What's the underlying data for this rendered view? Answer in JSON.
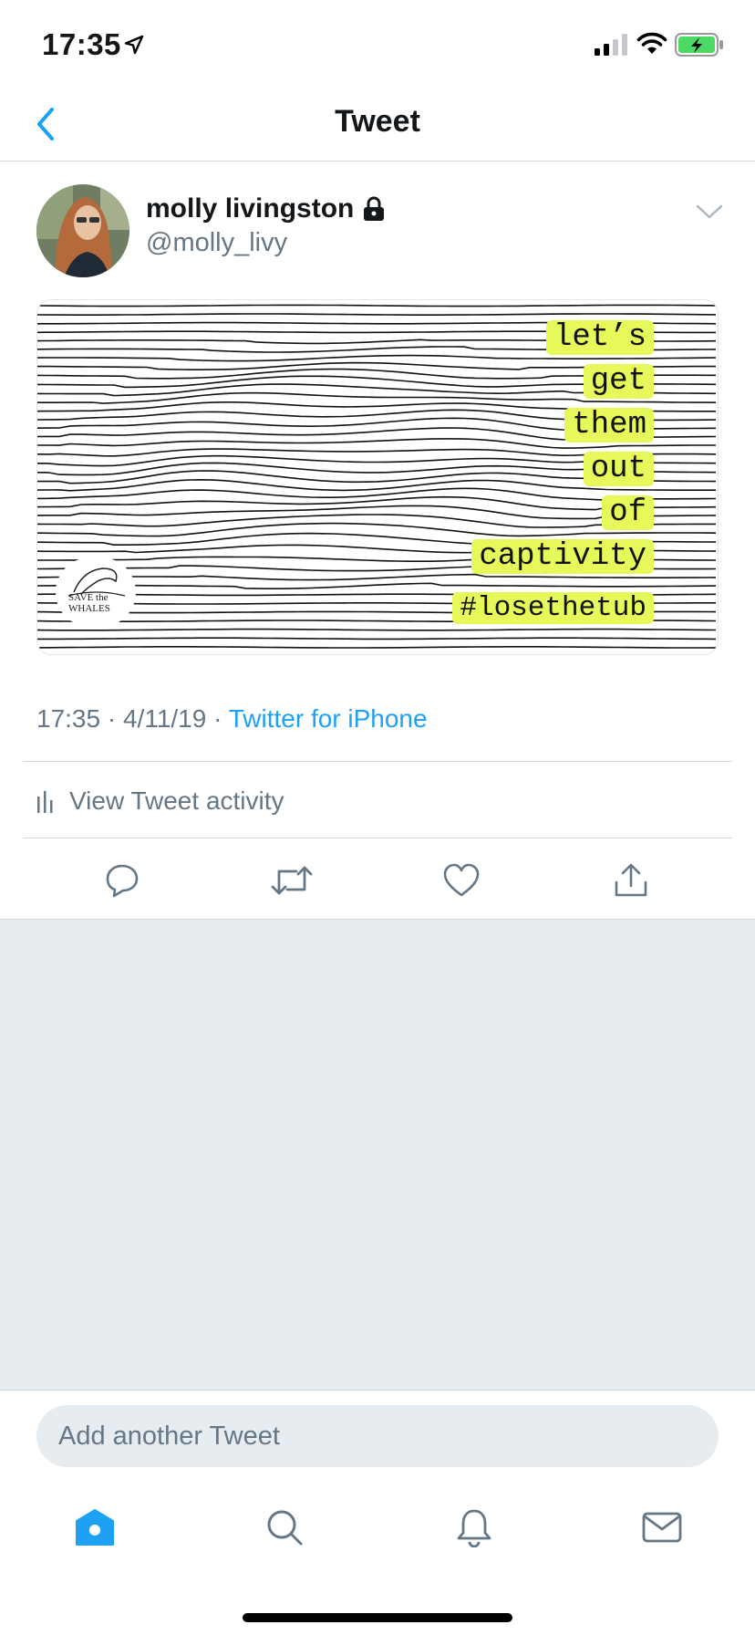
{
  "status_bar": {
    "time": "17:35",
    "icons": [
      "location-arrow-icon",
      "cellular-signal-icon",
      "wifi-icon",
      "battery-charging-icon"
    ]
  },
  "nav": {
    "title": "Tweet",
    "back_icon": "chevron-left-icon"
  },
  "tweet": {
    "author_name": "molly livingston",
    "author_handle": "@molly_livy",
    "protected_icon": "lock-icon",
    "menu_icon": "chevron-down-icon",
    "media": {
      "lines": [
        "let’s",
        "get",
        "them",
        "out",
        "of",
        "captivity"
      ],
      "hashtag": "#losethetub",
      "logo_text": [
        "SAVE the",
        "WHALES"
      ],
      "highlight_color": "#e6f85a"
    },
    "meta": {
      "time": "17:35",
      "separator": "·",
      "date": "4/11/19",
      "source": "Twitter for iPhone"
    },
    "activity_label": "View Tweet activity",
    "actions": [
      "reply-icon",
      "retweet-icon",
      "like-icon",
      "share-icon"
    ]
  },
  "compose": {
    "placeholder": "Add another Tweet"
  },
  "tabbar": {
    "tabs": [
      "home-icon",
      "search-icon",
      "notifications-icon",
      "messages-icon"
    ],
    "active": "home-icon"
  },
  "colors": {
    "accent": "#1da1f2",
    "secondary_text": "#657786",
    "background_gray": "#e6ecf0",
    "battery_green": "#4cd964"
  }
}
